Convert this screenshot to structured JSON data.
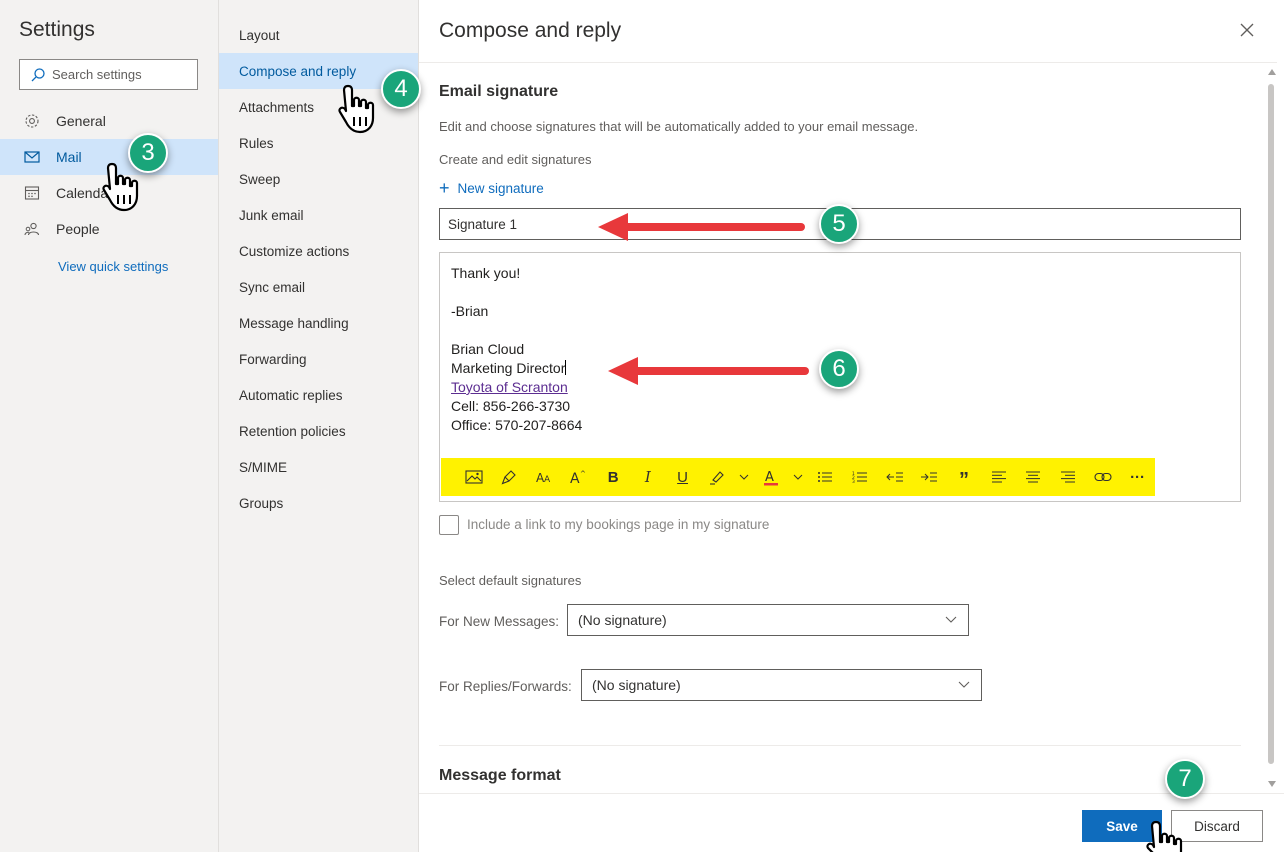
{
  "nav1": {
    "title": "Settings",
    "search_placeholder": "Search settings",
    "items": [
      {
        "label": "General",
        "icon": "gear-icon"
      },
      {
        "label": "Mail",
        "icon": "mail-icon"
      },
      {
        "label": "Calendar",
        "icon": "calendar-icon"
      },
      {
        "label": "People",
        "icon": "people-icon"
      }
    ],
    "quick_link": "View quick settings"
  },
  "nav2": {
    "items": [
      "Layout",
      "Compose and reply",
      "Attachments",
      "Rules",
      "Sweep",
      "Junk email",
      "Customize actions",
      "Sync email",
      "Message handling",
      "Forwarding",
      "Automatic replies",
      "Retention policies",
      "S/MIME",
      "Groups"
    ],
    "selected": "Compose and reply"
  },
  "panel": {
    "title": "Compose and reply",
    "section_title": "Email signature",
    "description": "Edit and choose signatures that will be automatically added to your email message.",
    "create_label": "Create and edit signatures",
    "new_signature": "New signature",
    "signature_name": "Signature 1",
    "signature_lines": [
      "Thank you!",
      "",
      "-Brian",
      "",
      "Brian Cloud",
      "Marketing Director",
      "Toyota of Scranton",
      "Cell: 856-266-3730",
      "Office: 570-207-8664"
    ],
    "signature_link_line": "Toyota of Scranton",
    "bookings_label": "Include a link to my bookings page in my signature",
    "defaults_title": "Select default signatures",
    "new_messages_label": "For New Messages:",
    "new_messages_value": "(No signature)",
    "replies_label": "For Replies/Forwards:",
    "replies_value": "(No signature)",
    "message_format_title": "Message format"
  },
  "toolbar": {
    "highlight_color": "#fff200",
    "tools": [
      "insert-image-icon",
      "format-painter-icon",
      "font-size-icon",
      "font-grow-icon",
      "bold-icon",
      "italic-icon",
      "underline-icon",
      "highlighter-icon",
      "font-color-icon",
      "bullets-icon",
      "numbering-icon",
      "outdent-icon",
      "indent-icon",
      "quote-icon",
      "align-left-icon",
      "align-center-icon",
      "align-right-icon",
      "link-icon",
      "more-icon"
    ],
    "bold_glyph": "B",
    "italic_glyph": "I",
    "underline_glyph": "U",
    "quote_glyph": "”",
    "more_glyph": "···"
  },
  "footer": {
    "save": "Save",
    "discard": "Discard"
  },
  "annotations": {
    "badges": [
      "3",
      "4",
      "5",
      "6",
      "7"
    ],
    "badge_color": "#1aa57a",
    "arrow_color": "#e8383b"
  },
  "colors": {
    "accent": "#0f6cbd",
    "nav_selected_bg": "#cfe4fa",
    "nav_bg": "#f3f2f1"
  }
}
